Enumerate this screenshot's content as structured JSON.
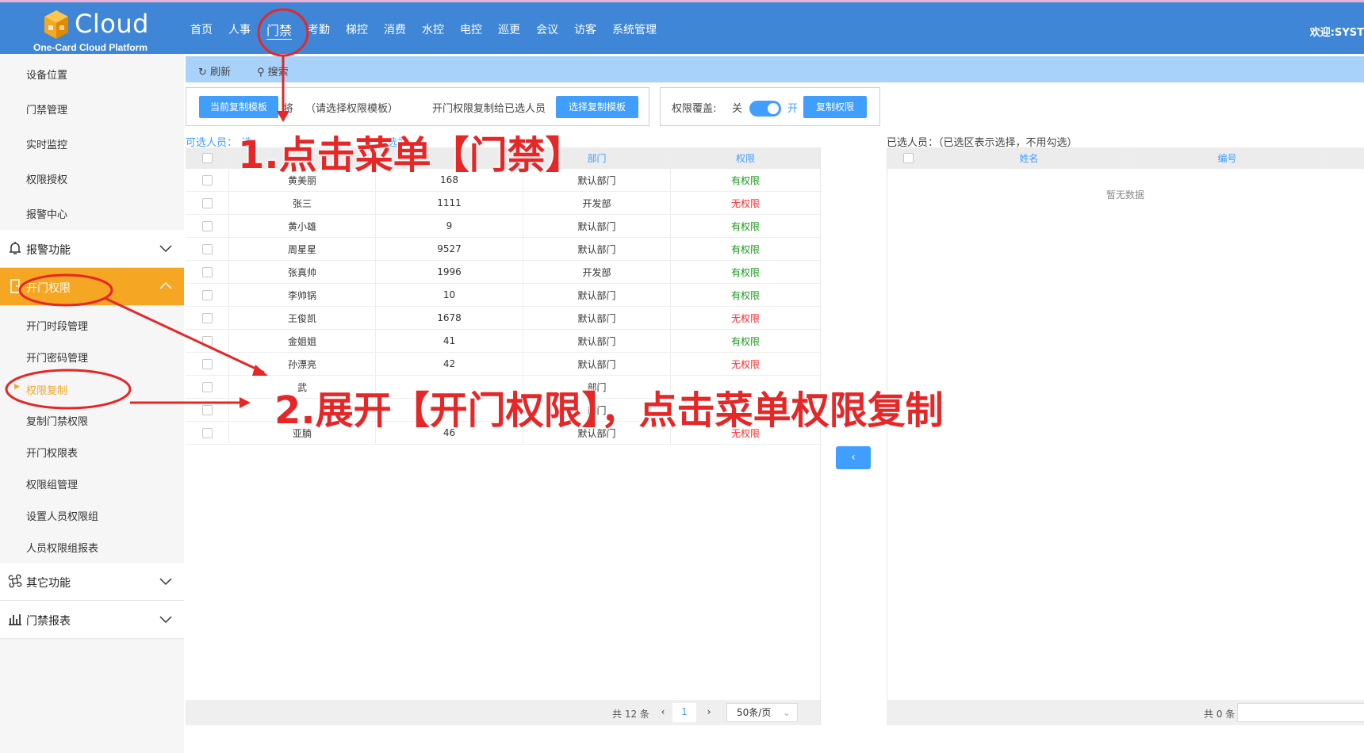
{
  "header": {
    "logo_text": "Cloud",
    "logo_subtitle": "One-Card Cloud Platform",
    "nav": [
      "首页",
      "人事",
      "门禁",
      "考勤",
      "梯控",
      "消费",
      "水控",
      "电控",
      "巡更",
      "会议",
      "访客",
      "系统管理"
    ],
    "active_nav": "门禁",
    "welcome": "欢迎:SYST"
  },
  "sidebar": {
    "top_items": [
      "设备位置",
      "门禁管理",
      "实时监控",
      "权限授权",
      "报警中心"
    ],
    "group_alarm": "报警功能",
    "group_open": "开门权限",
    "open_items": [
      "开门时段管理",
      "开门密码管理",
      "权限复制",
      "复制门禁权限",
      "开门权限表",
      "权限组管理",
      "设置人员权限组",
      "人员权限组报表"
    ],
    "current_item": "权限复制",
    "group_other": "其它功能",
    "group_report": "门禁报表"
  },
  "toolbar": {
    "refresh": "刷新",
    "search": "搜索"
  },
  "template": {
    "current_btn": "当前复制模板",
    "jiang": "将",
    "placeholder": "（请选择权限模板）",
    "copy_to": "开门权限复制给已选人员",
    "choose_btn": "选择复制模板"
  },
  "override": {
    "label": "权限覆盖:",
    "off": "关",
    "on": "开",
    "copy_btn": "复制权限"
  },
  "available": {
    "label": "可选人员：",
    "label_tail": "选",
    "label_tail2": "选为",
    "headers": [
      "",
      "",
      "部门",
      "权限"
    ],
    "rows": [
      {
        "name": "黄美丽",
        "no": "168",
        "dept": "默认部门",
        "perm": "有权限",
        "ok": true
      },
      {
        "name": "张三",
        "no": "1111",
        "dept": "开发部",
        "perm": "无权限",
        "ok": false
      },
      {
        "name": "黄小雄",
        "no": "9",
        "dept": "默认部门",
        "perm": "有权限",
        "ok": true
      },
      {
        "name": "周星星",
        "no": "9527",
        "dept": "默认部门",
        "perm": "有权限",
        "ok": true
      },
      {
        "name": "张真帅",
        "no": "1996",
        "dept": "开发部",
        "perm": "有权限",
        "ok": true
      },
      {
        "name": "李帅锅",
        "no": "10",
        "dept": "默认部门",
        "perm": "有权限",
        "ok": true
      },
      {
        "name": "王俊凯",
        "no": "1678",
        "dept": "默认部门",
        "perm": "无权限",
        "ok": false
      },
      {
        "name": "金姐姐",
        "no": "41",
        "dept": "默认部门",
        "perm": "有权限",
        "ok": true
      },
      {
        "name": "孙漂亮",
        "no": "42",
        "dept": "默认部门",
        "perm": "无权限",
        "ok": false
      },
      {
        "name": "武",
        "no": "",
        "dept": "部门",
        "perm": "",
        "ok": true
      },
      {
        "name": "",
        "no": "",
        "dept": "部门",
        "perm": "",
        "ok": true
      },
      {
        "name": "亚腩",
        "no": "46",
        "dept": "默认部门",
        "perm": "无权限",
        "ok": false
      }
    ],
    "total": "共 12 条",
    "page": "1",
    "page_size": "50条/页"
  },
  "selected": {
    "label": "已选人员：（已选区表示选择，不用勾选）",
    "headers": [
      "",
      "姓名",
      "编号",
      ""
    ],
    "empty": "暂无数据",
    "total": "共 0 条"
  },
  "move_btn": "‹",
  "annotations": {
    "step1": "1.点击菜单【门禁】",
    "step2": "2.展开【开门权限】，点击菜单权限复制"
  },
  "colors": {
    "header": "#3f86d6",
    "accent": "#f5a623",
    "button": "#409eff",
    "annotation": "#e52727",
    "has_perm": "#1a9a1a",
    "no_perm": "#ff2b2b"
  }
}
